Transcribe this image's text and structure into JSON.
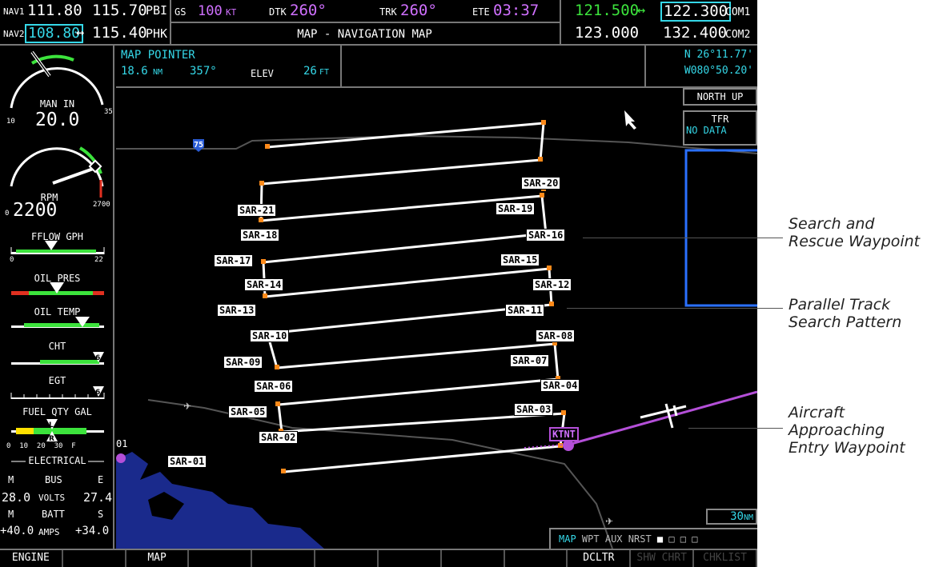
{
  "top": {
    "nav1_label": "NAV1",
    "nav1_active": "111.80",
    "nav1_standby": "115.70",
    "nav1_ident": "PBI",
    "nav2_label": "NAV2",
    "nav2_active": "108.80",
    "nav2_arrow": "↔",
    "nav2_standby": "115.40",
    "nav2_ident": "PHK",
    "gs_label": "GS",
    "gs_value": "100",
    "gs_unit": "KT",
    "dtk_label": "DTK",
    "dtk_value": "260°",
    "trk_label": "TRK",
    "trk_value": "260°",
    "ete_label": "ETE",
    "ete_value": "03:37",
    "page_title": "MAP - NAVIGATION MAP",
    "com1_active": "121.500",
    "com1_arrow": "↔",
    "com1_standby": "122.300",
    "com1_label": "COM1",
    "com2_active": "123.000",
    "com2_standby": "132.400",
    "com2_label": "COM2"
  },
  "engine": {
    "man_label": "MAN IN",
    "man_value": "20.0",
    "man_min": "10",
    "man_max": "35",
    "rpm_label": "RPM",
    "rpm_value": "2200",
    "rpm_min": "0",
    "rpm_max": "2700",
    "fflow_label": "FFLOW GPH",
    "fflow_min": "0",
    "fflow_max": "22",
    "oilp_label": "OIL PRES",
    "oilt_label": "OIL TEMP",
    "cht_label": "CHT",
    "egt_label": "EGT",
    "fuel_label": "FUEL QTY GAL",
    "fuel_ticks": "0  10  20  30  F",
    "elec_label": "ELECTRICAL",
    "bus_m": "M",
    "bus_label": "BUS",
    "bus_e": "E",
    "volts_left": "28.0",
    "volts_label": "VOLTS",
    "volts_right": "27.4",
    "batt_m": "M",
    "batt_label": "BATT",
    "batt_s": "S",
    "amps_left": "+40.0",
    "amps_label": "AMPS",
    "amps_right": "+34.0"
  },
  "pointer": {
    "title": "MAP POINTER",
    "dist": "18.6",
    "dist_unit": "NM",
    "bearing": "357°",
    "elev_label": "ELEV",
    "elev_value": "26",
    "elev_unit": "FT",
    "lat": "N 26°11.77'",
    "lon": "W080°50.20'"
  },
  "map": {
    "orientation": "NORTH UP",
    "tfr_label": "TFR",
    "tfr_status": "NO DATA",
    "highway": "75",
    "airport": "KTNT",
    "label_01": "01",
    "scale": "30",
    "scale_unit": "NM",
    "waypoints": [
      "SAR-01",
      "SAR-02",
      "SAR-03",
      "SAR-04",
      "SAR-05",
      "SAR-06",
      "SAR-07",
      "SAR-08",
      "SAR-09",
      "SAR-10",
      "SAR-11",
      "SAR-12",
      "SAR-13",
      "SAR-14",
      "SAR-15",
      "SAR-16",
      "SAR-17",
      "SAR-18",
      "SAR-19",
      "SAR-20",
      "SAR-21"
    ],
    "page_groups": [
      "MAP",
      "WPT",
      "AUX",
      "NRST"
    ]
  },
  "softkeys": [
    "ENGINE",
    "",
    "MAP",
    "",
    "",
    "",
    "",
    "",
    "",
    "DCLTR",
    "SHW CHRT",
    "CHKLIST"
  ],
  "callouts": {
    "search_rescue": [
      "Search and",
      "Rescue Waypoint"
    ],
    "parallel_track": [
      "Parallel Track",
      "Search Pattern"
    ],
    "aircraft": [
      "Aircraft",
      "Approaching",
      "Entry Waypoint"
    ]
  },
  "colors": {
    "cyan": "#35d8e8",
    "green": "#3ce33c",
    "magenta": "#d070ff",
    "lake_blue": "#1a2a8c"
  }
}
